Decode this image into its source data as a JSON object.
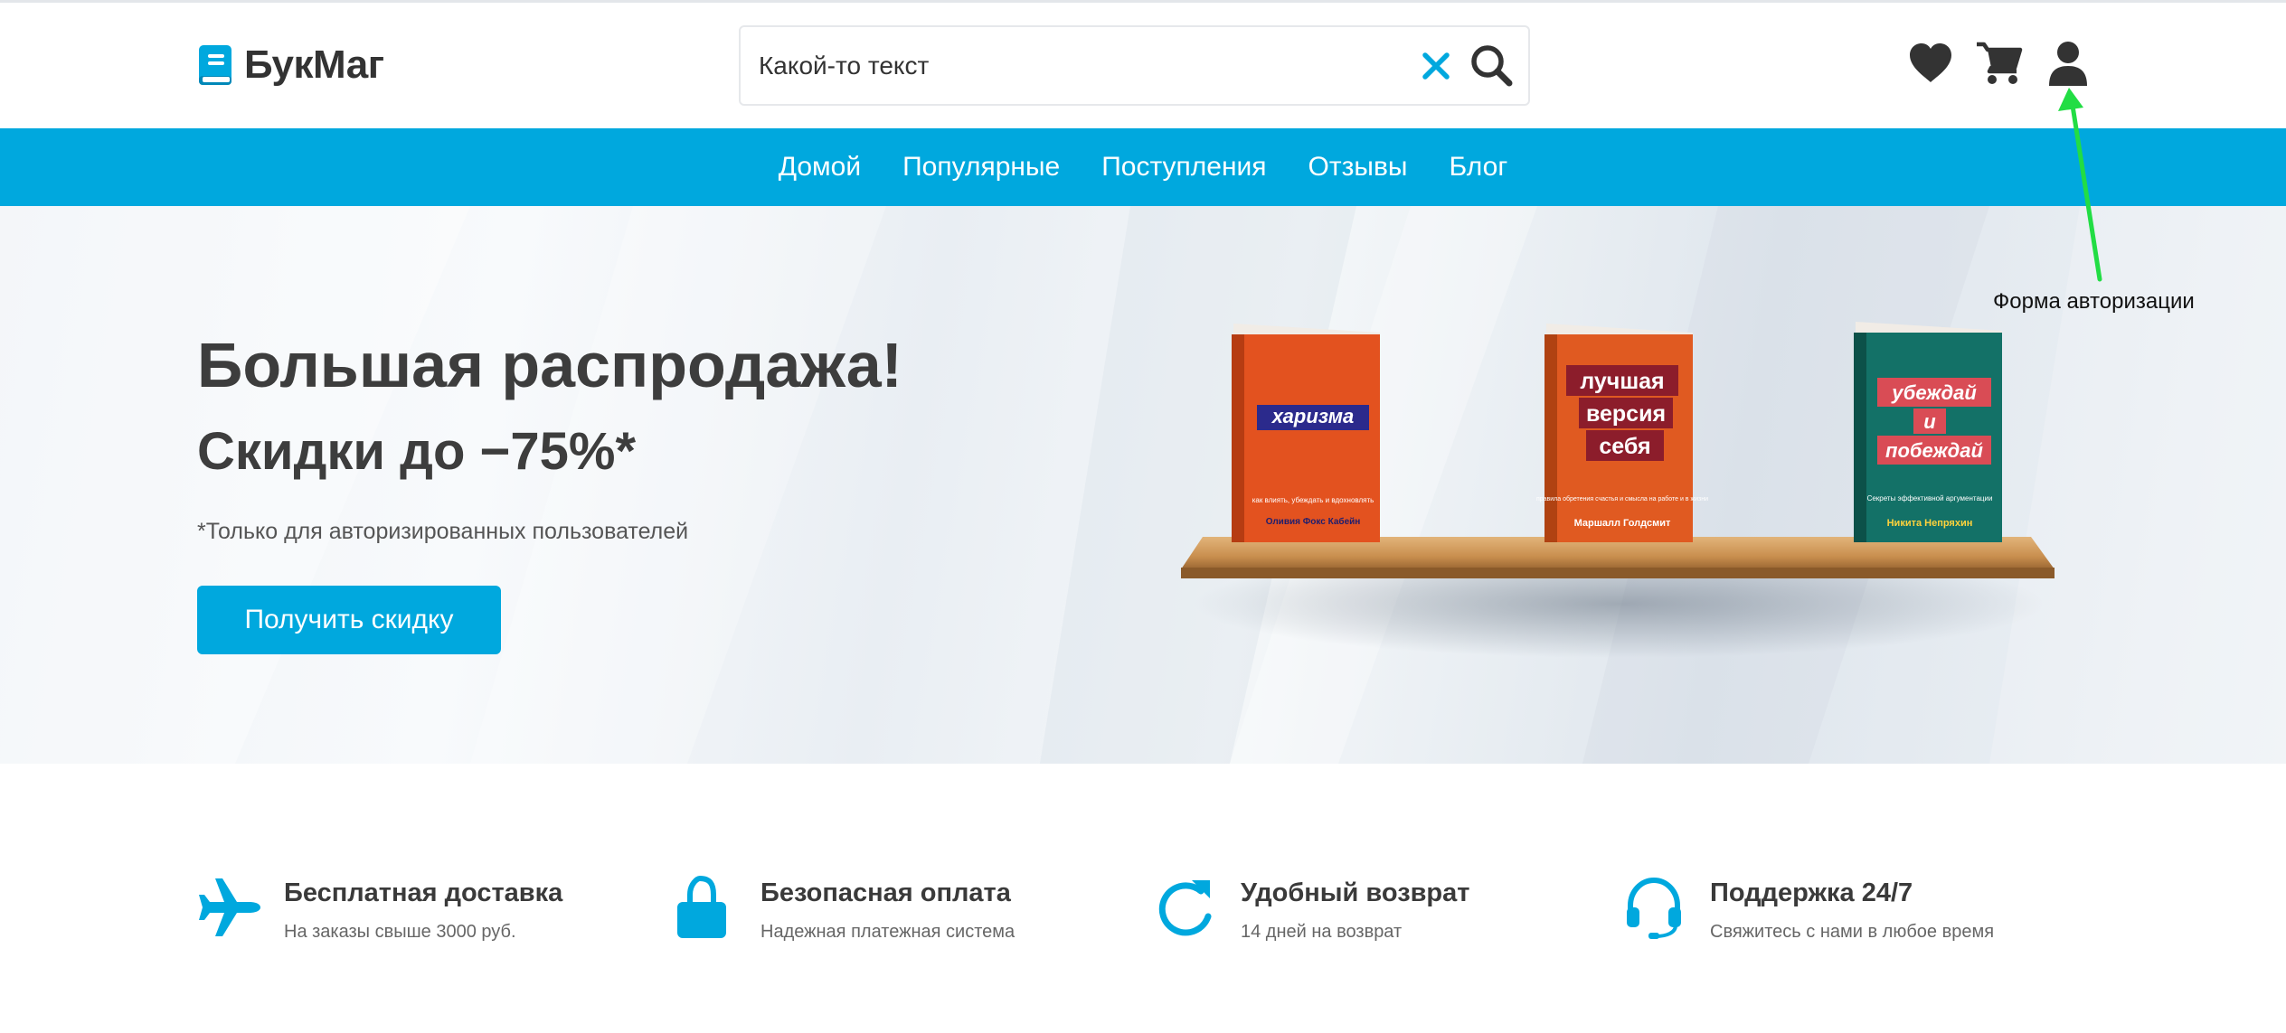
{
  "brand": {
    "name": "БукМаг",
    "accent_color": "#00a8de",
    "logo_icon": "book-icon"
  },
  "search": {
    "value": "Какой-то текст",
    "placeholder": "Какой-то текст",
    "clear_icon": "close-icon",
    "submit_icon": "search-icon"
  },
  "header_icons": [
    {
      "name": "favorites",
      "icon": "heart-icon"
    },
    {
      "name": "cart",
      "icon": "cart-icon"
    },
    {
      "name": "account",
      "icon": "user-icon"
    }
  ],
  "nav": {
    "items": [
      {
        "label": "Домой"
      },
      {
        "label": "Популярные"
      },
      {
        "label": "Поступления"
      },
      {
        "label": "Отзывы"
      },
      {
        "label": "Блог"
      }
    ]
  },
  "hero": {
    "title": "Большая распродажа!",
    "subtitle": "Скидки до −75%*",
    "note": "*Только для авторизированных пользователей",
    "button_label": "Получить скидку",
    "books": [
      {
        "title": "харизма",
        "tagline": "как влиять, убеждать и вдохновлять",
        "author": "Оливия Фокс Кабейн",
        "cover_color": "#e3521f"
      },
      {
        "title_lines": [
          "лучшая",
          "версия",
          "себя"
        ],
        "tagline": "правила обретения счастья и смысла на работе и в жизни",
        "author": "Маршалл Голдсмит",
        "cover_color": "#e05a21"
      },
      {
        "title_lines": [
          "убеждай",
          "и",
          "побеждай"
        ],
        "tagline": "Секреты эффективной аргументации",
        "author": "Никита Непряхин",
        "cover_color": "#137167"
      }
    ]
  },
  "features": [
    {
      "icon": "airplane-icon",
      "title": "Бесплатная доставка",
      "desc": "На заказы свыше 3000 руб."
    },
    {
      "icon": "lock-icon",
      "title": "Безопасная оплата",
      "desc": "Надежная платежная система"
    },
    {
      "icon": "refresh-icon",
      "title": "Удобный возврат",
      "desc": "14 дней на возврат"
    },
    {
      "icon": "headset-icon",
      "title": "Поддержка 24/7",
      "desc": "Свяжитесь с нами в любое время"
    }
  ],
  "annotation": {
    "label": "Форма авторизации",
    "color": "#22dd44"
  }
}
